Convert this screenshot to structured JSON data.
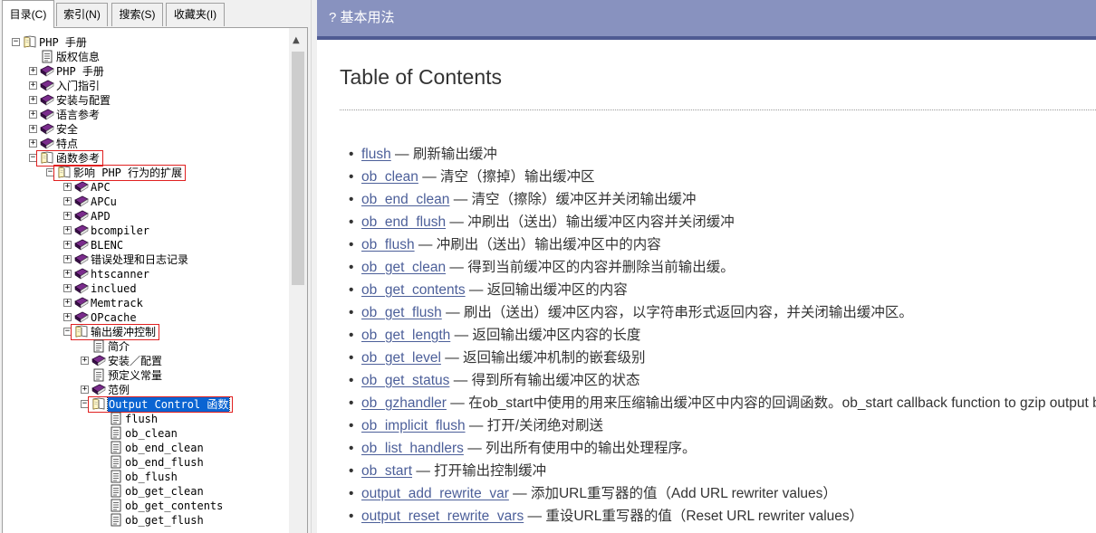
{
  "tabs": [
    {
      "label": "目录(C)",
      "active": true
    },
    {
      "label": "索引(N)",
      "active": false
    },
    {
      "label": "搜索(S)",
      "active": false
    },
    {
      "label": "收藏夹(I)",
      "active": false
    }
  ],
  "tree": [
    {
      "label": "PHP 手册",
      "level": 0,
      "icon": "book-open-icon",
      "expander": "minus"
    },
    {
      "label": "版权信息",
      "level": 1,
      "icon": "page-icon",
      "expander": ""
    },
    {
      "label": "PHP 手册",
      "level": 1,
      "icon": "book-closed-icon",
      "expander": "plus"
    },
    {
      "label": "入门指引",
      "level": 1,
      "icon": "book-closed-icon",
      "expander": "plus"
    },
    {
      "label": "安装与配置",
      "level": 1,
      "icon": "book-closed-icon",
      "expander": "plus"
    },
    {
      "label": "语言参考",
      "level": 1,
      "icon": "book-closed-icon",
      "expander": "plus"
    },
    {
      "label": "安全",
      "level": 1,
      "icon": "book-closed-icon",
      "expander": "plus"
    },
    {
      "label": "特点",
      "level": 1,
      "icon": "book-closed-icon",
      "expander": "plus"
    },
    {
      "label": "函数参考",
      "level": 1,
      "icon": "book-open-icon",
      "expander": "minus",
      "highlight": true
    },
    {
      "label": "影响 PHP 行为的扩展",
      "level": 2,
      "icon": "book-open-icon",
      "expander": "minus",
      "highlight": true
    },
    {
      "label": "APC",
      "level": 3,
      "icon": "book-closed-icon",
      "expander": "plus"
    },
    {
      "label": "APCu",
      "level": 3,
      "icon": "book-closed-icon",
      "expander": "plus"
    },
    {
      "label": "APD",
      "level": 3,
      "icon": "book-closed-icon",
      "expander": "plus"
    },
    {
      "label": "bcompiler",
      "level": 3,
      "icon": "book-closed-icon",
      "expander": "plus"
    },
    {
      "label": "BLENC",
      "level": 3,
      "icon": "book-closed-icon",
      "expander": "plus"
    },
    {
      "label": "错误处理和日志记录",
      "level": 3,
      "icon": "book-closed-icon",
      "expander": "plus"
    },
    {
      "label": "htscanner",
      "level": 3,
      "icon": "book-closed-icon",
      "expander": "plus"
    },
    {
      "label": "inclued",
      "level": 3,
      "icon": "book-closed-icon",
      "expander": "plus"
    },
    {
      "label": "Memtrack",
      "level": 3,
      "icon": "book-closed-icon",
      "expander": "plus"
    },
    {
      "label": "OPcache",
      "level": 3,
      "icon": "book-closed-icon",
      "expander": "plus"
    },
    {
      "label": "输出缓冲控制",
      "level": 3,
      "icon": "book-open-icon",
      "expander": "minus",
      "highlight": true
    },
    {
      "label": "简介",
      "level": 4,
      "icon": "page-icon",
      "expander": ""
    },
    {
      "label": "安装／配置",
      "level": 4,
      "icon": "book-closed-icon",
      "expander": "plus"
    },
    {
      "label": "预定义常量",
      "level": 4,
      "icon": "page-icon",
      "expander": ""
    },
    {
      "label": "范例",
      "level": 4,
      "icon": "book-closed-icon",
      "expander": "plus"
    },
    {
      "label": "Output Control 函数",
      "level": 4,
      "icon": "book-open-icon",
      "expander": "minus",
      "highlight": true,
      "selected": true
    },
    {
      "label": "flush",
      "level": 5,
      "icon": "page-icon",
      "expander": ""
    },
    {
      "label": "ob_clean",
      "level": 5,
      "icon": "page-icon",
      "expander": ""
    },
    {
      "label": "ob_end_clean",
      "level": 5,
      "icon": "page-icon",
      "expander": ""
    },
    {
      "label": "ob_end_flush",
      "level": 5,
      "icon": "page-icon",
      "expander": ""
    },
    {
      "label": "ob_flush",
      "level": 5,
      "icon": "page-icon",
      "expander": ""
    },
    {
      "label": "ob_get_clean",
      "level": 5,
      "icon": "page-icon",
      "expander": ""
    },
    {
      "label": "ob_get_contents",
      "level": 5,
      "icon": "page-icon",
      "expander": ""
    },
    {
      "label": "ob_get_flush",
      "level": 5,
      "icon": "page-icon",
      "expander": ""
    }
  ],
  "header": {
    "title": "? 基本用法"
  },
  "main": {
    "title": "Table of Contents",
    "entries": [
      {
        "name": "flush",
        "desc": " — 刷新输出缓冲"
      },
      {
        "name": "ob_clean",
        "desc": " — 清空（擦掉）输出缓冲区"
      },
      {
        "name": "ob_end_clean",
        "desc": " — 清空（擦除）缓冲区并关闭输出缓冲"
      },
      {
        "name": "ob_end_flush",
        "desc": " — 冲刷出（送出）输出缓冲区内容并关闭缓冲"
      },
      {
        "name": "ob_flush",
        "desc": " — 冲刷出（送出）输出缓冲区中的内容"
      },
      {
        "name": "ob_get_clean",
        "desc": " — 得到当前缓冲区的内容并删除当前输出缓。"
      },
      {
        "name": "ob_get_contents",
        "desc": " — 返回输出缓冲区的内容"
      },
      {
        "name": "ob_get_flush",
        "desc": " — 刷出（送出）缓冲区内容，以字符串形式返回内容，并关闭输出缓冲区。"
      },
      {
        "name": "ob_get_length",
        "desc": " — 返回输出缓冲区内容的长度"
      },
      {
        "name": "ob_get_level",
        "desc": " — 返回输出缓冲机制的嵌套级别"
      },
      {
        "name": "ob_get_status",
        "desc": " — 得到所有输出缓冲区的状态"
      },
      {
        "name": "ob_gzhandler",
        "desc": " — 在ob_start中使用的用来压缩输出缓冲区中内容的回调函数。ob_start callback function to gzip output buffer"
      },
      {
        "name": "ob_implicit_flush",
        "desc": " — 打开/关闭绝对刷送"
      },
      {
        "name": "ob_list_handlers",
        "desc": " — 列出所有使用中的输出处理程序。"
      },
      {
        "name": "ob_start",
        "desc": " — 打开输出控制缓冲"
      },
      {
        "name": "output_add_rewrite_var",
        "desc": " — 添加URL重写器的值（Add URL rewriter values）"
      },
      {
        "name": "output_reset_rewrite_vars",
        "desc": " — 重设URL重写器的值（Reset URL rewriter values）"
      }
    ]
  },
  "colors": {
    "header_bg": "#8892bf",
    "link": "#4c5f99",
    "highlight_box": "#e02020",
    "selection": "#0a64d2"
  }
}
